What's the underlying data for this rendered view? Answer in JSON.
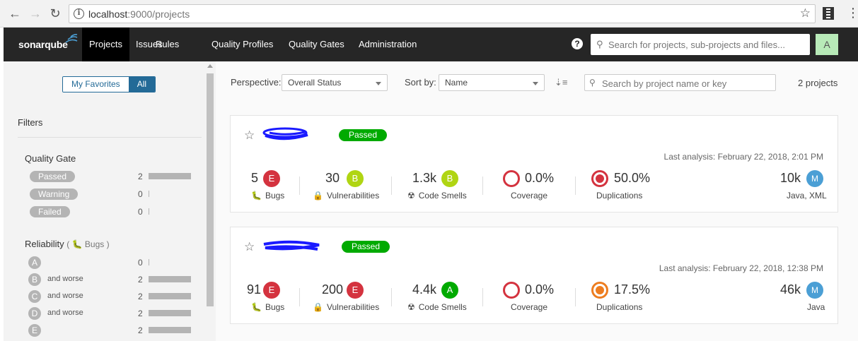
{
  "browser": {
    "url_host": "localhost",
    "url_rest": ":9000/projects"
  },
  "nav": {
    "logo": "sonarqube",
    "items": [
      "Projects",
      "Issues",
      "Rules",
      "Quality Profiles",
      "Quality Gates",
      "Administration"
    ],
    "active": "Projects",
    "help": "?",
    "search_placeholder": "Search for projects, sub-projects and files...",
    "avatar": "A",
    "avatar_color": "#b8eab8"
  },
  "sidebar": {
    "toggle": [
      "My Favorites",
      "All"
    ],
    "filters_title": "Filters",
    "quality_gate": {
      "title": "Quality Gate",
      "rows": [
        {
          "label": "Passed",
          "count": "2",
          "fraction": 1.0
        },
        {
          "label": "Warning",
          "count": "0",
          "fraction": 0
        },
        {
          "label": "Failed",
          "count": "0",
          "fraction": 0
        }
      ]
    },
    "reliability": {
      "title": "Reliability",
      "subtitle": "Bugs",
      "rows": [
        {
          "label": "A",
          "suffix": "",
          "count": "0",
          "fraction": 0
        },
        {
          "label": "B",
          "suffix": "and worse",
          "count": "2",
          "fraction": 1.0
        },
        {
          "label": "C",
          "suffix": "and worse",
          "count": "2",
          "fraction": 1.0
        },
        {
          "label": "D",
          "suffix": "and worse",
          "count": "2",
          "fraction": 1.0
        },
        {
          "label": "E",
          "suffix": "",
          "count": "2",
          "fraction": 1.0
        }
      ]
    }
  },
  "toolbar": {
    "perspective_label": "Perspective:",
    "perspective_value": "Overall Status",
    "sortby_label": "Sort by:",
    "sortby_value": "Name",
    "search_placeholder": "Search by project name or key",
    "count": "2 projects"
  },
  "colors": {
    "rating_A": "#00aa00",
    "rating_B": "#b0d513",
    "rating_E": "#d4333f",
    "passed": "#00aa00",
    "dup_high": "#d4333f",
    "dup_mid": "#ed7d20",
    "loc": "#4b9fd5"
  },
  "projects": [
    {
      "status": "Passed",
      "analysis": "Last analysis: February 22, 2018, 2:01 PM",
      "bugs": "5",
      "bugs_rating": "E",
      "bugs_label": "Bugs",
      "vulns": "30",
      "vulns_rating": "B",
      "vulns_label": "Vulnerabilities",
      "smells": "1.3k",
      "smells_rating": "B",
      "smells_label": "Code Smells",
      "coverage": "0.0%",
      "coverage_label": "Coverage",
      "duplications": "50.0%",
      "duplications_label": "Duplications",
      "loc": "10k",
      "size": "M",
      "languages": "Java, XML"
    },
    {
      "status": "Passed",
      "analysis": "Last analysis: February 22, 2018, 12:38 PM",
      "bugs": "91",
      "bugs_rating": "E",
      "bugs_label": "Bugs",
      "vulns": "200",
      "vulns_rating": "E",
      "vulns_label": "Vulnerabilities",
      "smells": "4.4k",
      "smells_rating": "A",
      "smells_label": "Code Smells",
      "coverage": "0.0%",
      "coverage_label": "Coverage",
      "duplications": "17.5%",
      "duplications_label": "Duplications",
      "loc": "46k",
      "size": "M",
      "languages": "Java"
    }
  ]
}
